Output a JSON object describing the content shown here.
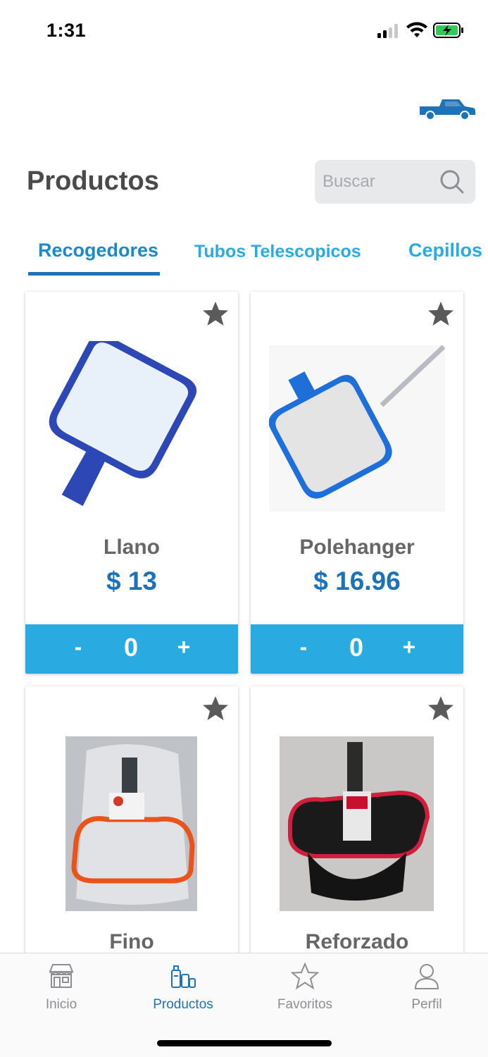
{
  "status_bar": {
    "time": "1:31"
  },
  "header": {
    "title": "Productos",
    "search_placeholder": "Buscar",
    "icons": [
      "truck-icon",
      "search-icon"
    ]
  },
  "tabs": [
    {
      "label": "Recogedores",
      "active": true
    },
    {
      "label": "Tubos Telescopicos",
      "active": false
    },
    {
      "label": "Cepillos",
      "active": false
    }
  ],
  "products": [
    {
      "name": "Llano",
      "price": "$ 13",
      "qty": "0",
      "minus": "-",
      "plus": "+",
      "image": "blue-leaf-skimmer"
    },
    {
      "name": "Polehanger",
      "price": "$ 16.96",
      "qty": "0",
      "minus": "-",
      "plus": "+",
      "image": "skimmer-with-pole"
    },
    {
      "name": "Fino",
      "image": "bagged-orange-skimmer"
    },
    {
      "name": "Reforzado",
      "image": "red-deep-bag-skimmer"
    }
  ],
  "nav": [
    {
      "label": "Inicio",
      "icon": "store-icon",
      "active": false
    },
    {
      "label": "Productos",
      "icon": "products-icon",
      "active": true
    },
    {
      "label": "Favoritos",
      "icon": "star-outline-icon",
      "active": false
    },
    {
      "label": "Perfil",
      "icon": "user-icon",
      "active": false
    }
  ],
  "colors": {
    "accent": "#29abe2",
    "brand_blue": "#1d72b8",
    "title_gray": "#4a4a4a",
    "inactive_gray": "#8e8e93"
  }
}
